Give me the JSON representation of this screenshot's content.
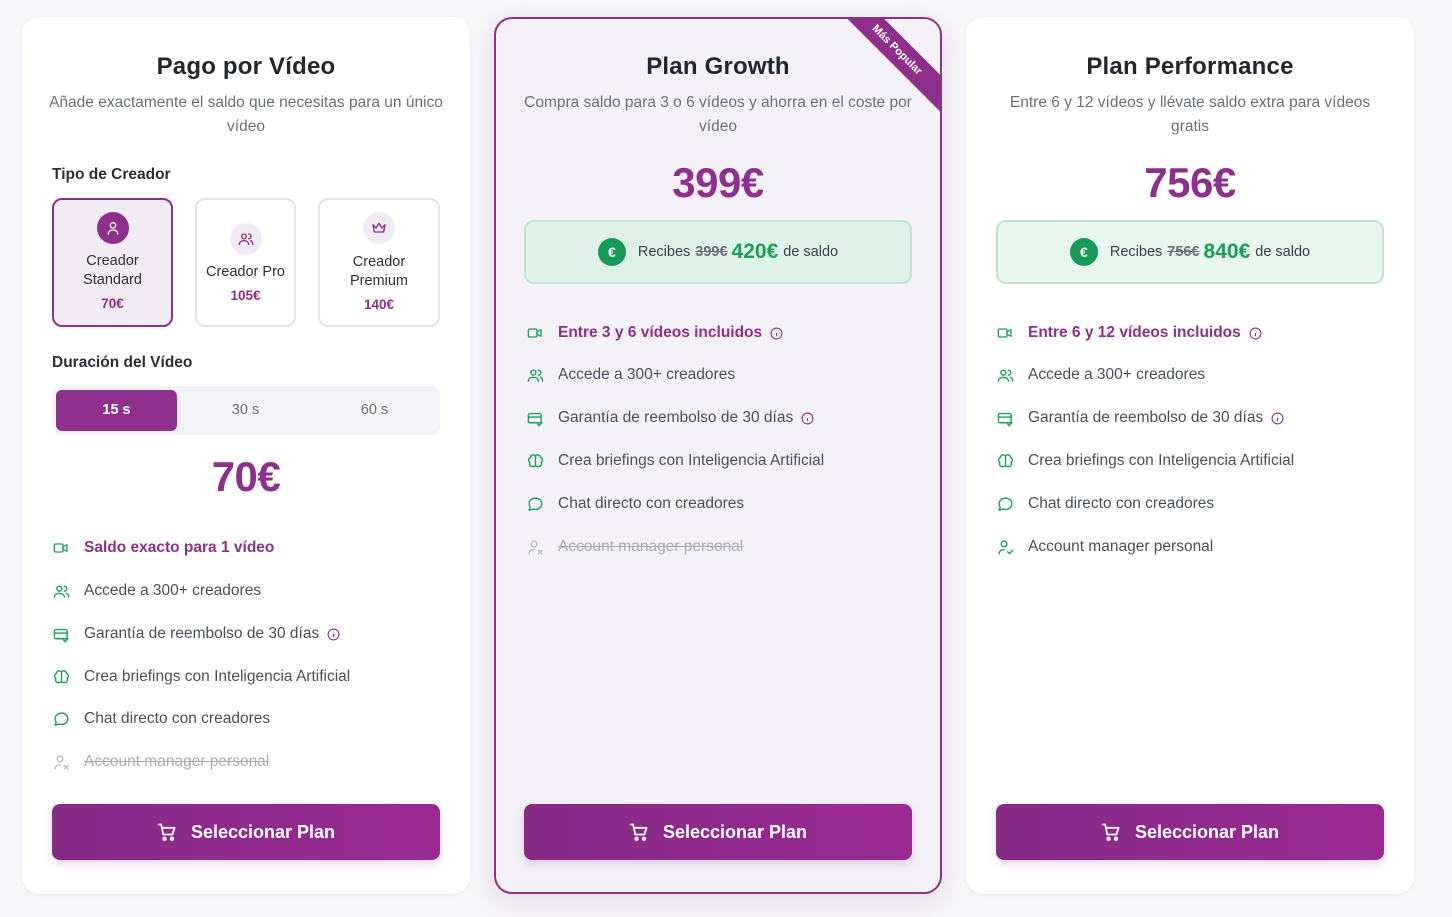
{
  "colors": {
    "brand": "#8e2f8c",
    "green": "#16a055",
    "text": "#2b2f3a",
    "muted": "#6b6f7a"
  },
  "plans": [
    {
      "title": "Pago por Vídeo",
      "subtitle": "Añade exactamente el saldo que necesitas para un único vídeo",
      "creator_type_label": "Tipo de Creador",
      "creators": [
        {
          "name": "Creador Standard",
          "price": "70€",
          "icon": "user-icon",
          "selected": true
        },
        {
          "name": "Creador Pro",
          "price": "105€",
          "icon": "users-icon",
          "selected": false
        },
        {
          "name": "Creador Premium",
          "price": "140€",
          "icon": "crown-icon",
          "selected": false
        }
      ],
      "duration_label": "Duración del Vídeo",
      "durations": [
        "15 s",
        "30 s",
        "60 s"
      ],
      "selected_duration": "15 s",
      "price": "70€",
      "features": [
        {
          "text": "Saldo exacto para 1 vídeo",
          "icon": "video-icon",
          "state": "highlight",
          "info": false
        },
        {
          "text": "Accede a 300+ creadores",
          "icon": "users-icon",
          "state": "normal",
          "info": false
        },
        {
          "text": "Garantía de reembolso de 30 días",
          "icon": "refund-icon",
          "state": "normal",
          "info": true
        },
        {
          "text": "Crea briefings con Inteligencia Artificial",
          "icon": "brain-icon",
          "state": "normal",
          "info": false
        },
        {
          "text": "Chat directo con creadores",
          "icon": "chat-icon",
          "state": "normal",
          "info": false
        },
        {
          "text": "Account manager personal",
          "icon": "user-x-icon",
          "state": "disabled",
          "info": false
        }
      ],
      "cta": "Seleccionar Plan"
    },
    {
      "title": "Plan Growth",
      "subtitle": "Compra saldo para 3 o 6 vídeos y ahorra en el coste por vídeo",
      "badge": "Más Popular",
      "price": "399€",
      "bonus": {
        "prefix": "Recibes",
        "old": "399€",
        "new": "420€",
        "suffix": "de saldo"
      },
      "features": [
        {
          "text": "Entre 3 y 6 vídeos incluidos",
          "icon": "video-icon",
          "state": "highlight",
          "info": true
        },
        {
          "text": "Accede a 300+ creadores",
          "icon": "users-icon",
          "state": "normal",
          "info": false
        },
        {
          "text": "Garantía de reembolso de 30 días",
          "icon": "refund-icon",
          "state": "normal",
          "info": true
        },
        {
          "text": "Crea briefings con Inteligencia Artificial",
          "icon": "brain-icon",
          "state": "normal",
          "info": false
        },
        {
          "text": "Chat directo con creadores",
          "icon": "chat-icon",
          "state": "normal",
          "info": false
        },
        {
          "text": "Account manager personal",
          "icon": "user-x-icon",
          "state": "disabled",
          "info": false
        }
      ],
      "cta": "Seleccionar Plan"
    },
    {
      "title": "Plan Performance",
      "subtitle": "Entre 6 y 12 vídeos y llévate saldo extra para vídeos gratis",
      "price": "756€",
      "bonus": {
        "prefix": "Recibes",
        "old": "756€",
        "new": "840€",
        "suffix": "de saldo"
      },
      "features": [
        {
          "text": "Entre 6 y 12 vídeos incluidos",
          "icon": "video-icon",
          "state": "highlight",
          "info": true
        },
        {
          "text": "Accede a 300+ creadores",
          "icon": "users-icon",
          "state": "normal",
          "info": false
        },
        {
          "text": "Garantía de reembolso de 30 días",
          "icon": "refund-icon",
          "state": "normal",
          "info": true
        },
        {
          "text": "Crea briefings con Inteligencia Artificial",
          "icon": "brain-icon",
          "state": "normal",
          "info": false
        },
        {
          "text": "Chat directo con creadores",
          "icon": "chat-icon",
          "state": "normal",
          "info": false
        },
        {
          "text": "Account manager personal",
          "icon": "user-check-icon",
          "state": "normal",
          "info": false
        }
      ],
      "cta": "Seleccionar Plan"
    }
  ]
}
